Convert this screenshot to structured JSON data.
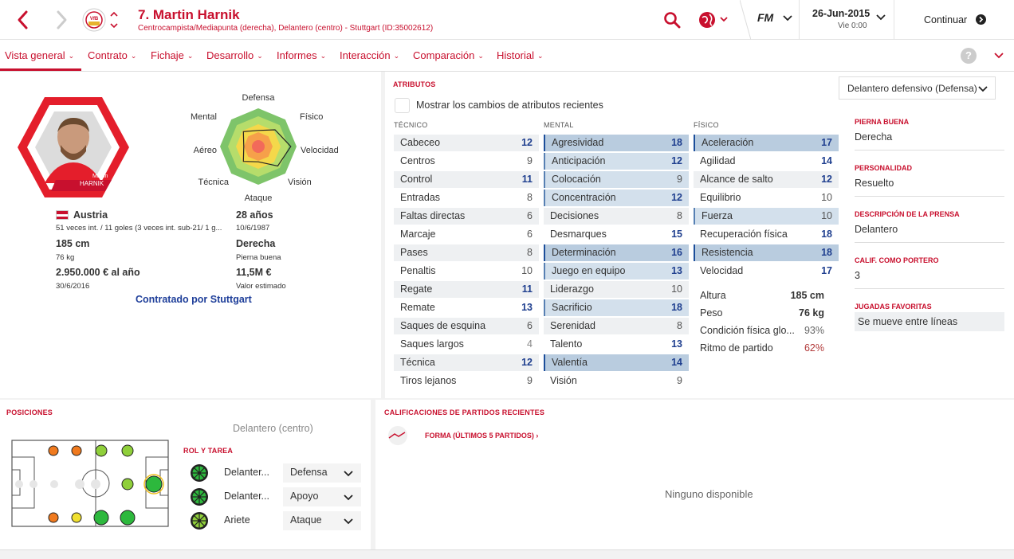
{
  "header": {
    "title": "7. Martin Harnik",
    "subtitle": "Centrocampista/Mediapunta (derecha), Delantero (centro) - Stuttgart (ID:35002612)",
    "club_badge": "VfB",
    "logo": "FM",
    "date": "26-Jun-2015",
    "day": "Vie 0:00",
    "continue": "Continuar"
  },
  "tabs": [
    {
      "label": "Vista general"
    },
    {
      "label": "Contrato"
    },
    {
      "label": "Fichaje"
    },
    {
      "label": "Desarrollo"
    },
    {
      "label": "Informes"
    },
    {
      "label": "Interacción"
    },
    {
      "label": "Comparación"
    },
    {
      "label": "Historial"
    }
  ],
  "player": {
    "photo_name_small": "Martin",
    "photo_name_big": "HARNIK",
    "nationality": "Austria",
    "caps": "51 veces int. / 11 goles (3 veces int. sub-21/ 1 g...",
    "age": "28 años",
    "birth": "10/6/1987",
    "height": "185 cm",
    "weight": "76 kg",
    "foot": "Derecha",
    "foot_label": "Pierna buena",
    "wage": "2.950.000 € al año",
    "contract_end": "30/6/2016",
    "value": "11,5M €",
    "value_label": "Valor estimado",
    "signed_by": "Contratado por Stuttgart"
  },
  "radar": {
    "labels": [
      "Defensa",
      "Físico",
      "Velocidad",
      "Visión",
      "Ataque",
      "Técnica",
      "Aéreo",
      "Mental"
    ],
    "values": [
      0.42,
      0.62,
      0.85,
      0.72,
      0.4,
      0.55,
      0.38,
      0.55
    ]
  },
  "attributes": {
    "title": "ATRIBUTOS",
    "role_dropdown": "Delantero defensivo (Defensa)",
    "checkbox_label": "Mostrar los cambios de atributos recientes",
    "tecnico_title": "TÉCNICO",
    "mental_title": "MENTAL",
    "fisico_title": "FÍSICO",
    "tecnico": [
      {
        "name": "Cabeceo",
        "value": "12"
      },
      {
        "name": "Centros",
        "value": "9"
      },
      {
        "name": "Control",
        "value": "11"
      },
      {
        "name": "Entradas",
        "value": "8"
      },
      {
        "name": "Faltas directas",
        "value": "6"
      },
      {
        "name": "Marcaje",
        "value": "6"
      },
      {
        "name": "Pases",
        "value": "8"
      },
      {
        "name": "Penaltis",
        "value": "10"
      },
      {
        "name": "Regate",
        "value": "11"
      },
      {
        "name": "Remate",
        "value": "13"
      },
      {
        "name": "Saques de esquina",
        "value": "6"
      },
      {
        "name": "Saques largos",
        "value": "4"
      },
      {
        "name": "Técnica",
        "value": "12"
      },
      {
        "name": "Tiros lejanos",
        "value": "9"
      }
    ],
    "mental": [
      {
        "name": "Agresividad",
        "value": "18"
      },
      {
        "name": "Anticipación",
        "value": "12"
      },
      {
        "name": "Colocación",
        "value": "9"
      },
      {
        "name": "Concentración",
        "value": "12"
      },
      {
        "name": "Decisiones",
        "value": "8"
      },
      {
        "name": "Desmarques",
        "value": "15"
      },
      {
        "name": "Determinación",
        "value": "16"
      },
      {
        "name": "Juego en equipo",
        "value": "13"
      },
      {
        "name": "Liderazgo",
        "value": "10"
      },
      {
        "name": "Sacrificio",
        "value": "18"
      },
      {
        "name": "Serenidad",
        "value": "8"
      },
      {
        "name": "Talento",
        "value": "13"
      },
      {
        "name": "Valentía",
        "value": "14"
      },
      {
        "name": "Visión",
        "value": "9"
      }
    ],
    "fisico": [
      {
        "name": "Aceleración",
        "value": "17"
      },
      {
        "name": "Agilidad",
        "value": "14"
      },
      {
        "name": "Alcance de salto",
        "value": "12"
      },
      {
        "name": "Equilibrio",
        "value": "10"
      },
      {
        "name": "Fuerza",
        "value": "10"
      },
      {
        "name": "Recuperación física",
        "value": "18"
      },
      {
        "name": "Resistencia",
        "value": "18"
      },
      {
        "name": "Velocidad",
        "value": "17"
      }
    ],
    "extras": [
      {
        "name": "Altura",
        "value": "185 cm"
      },
      {
        "name": "Peso",
        "value": "76 kg"
      },
      {
        "name": "Condición física glo...",
        "value": "93%"
      },
      {
        "name": "Ritmo de partido",
        "value": "62%"
      }
    ]
  },
  "side_info": [
    {
      "label": "PIERNA BUENA",
      "value": "Derecha"
    },
    {
      "label": "PERSONALIDAD",
      "value": "Resuelto"
    },
    {
      "label": "DESCRIPCIÓN DE LA PRENSA",
      "value": "Delantero"
    },
    {
      "label": "CALIF. COMO PORTERO",
      "value": "3"
    },
    {
      "label": "JUGADAS FAVORITAS",
      "value": "Se mueve entre líneas"
    }
  ],
  "positions": {
    "title": "POSICIONES",
    "main_position": "Delantero (centro)",
    "roles_title": "ROL Y TAREA",
    "roles": [
      {
        "role": "Delanter...",
        "duty": "Defensa"
      },
      {
        "role": "Delanter...",
        "duty": "Apoyo"
      },
      {
        "role": "Ariete",
        "duty": "Ataque"
      }
    ]
  },
  "form": {
    "title": "CALIFICACIONES DE PARTIDOS RECIENTES",
    "link": "FORMA (ÚLTIMOS 5 PARTIDOS)",
    "empty": "Ninguno disponible"
  },
  "colors": {
    "accent": "#c8102e",
    "highlight": "#b9ccdf",
    "value_blue": "#1f3f8f"
  }
}
